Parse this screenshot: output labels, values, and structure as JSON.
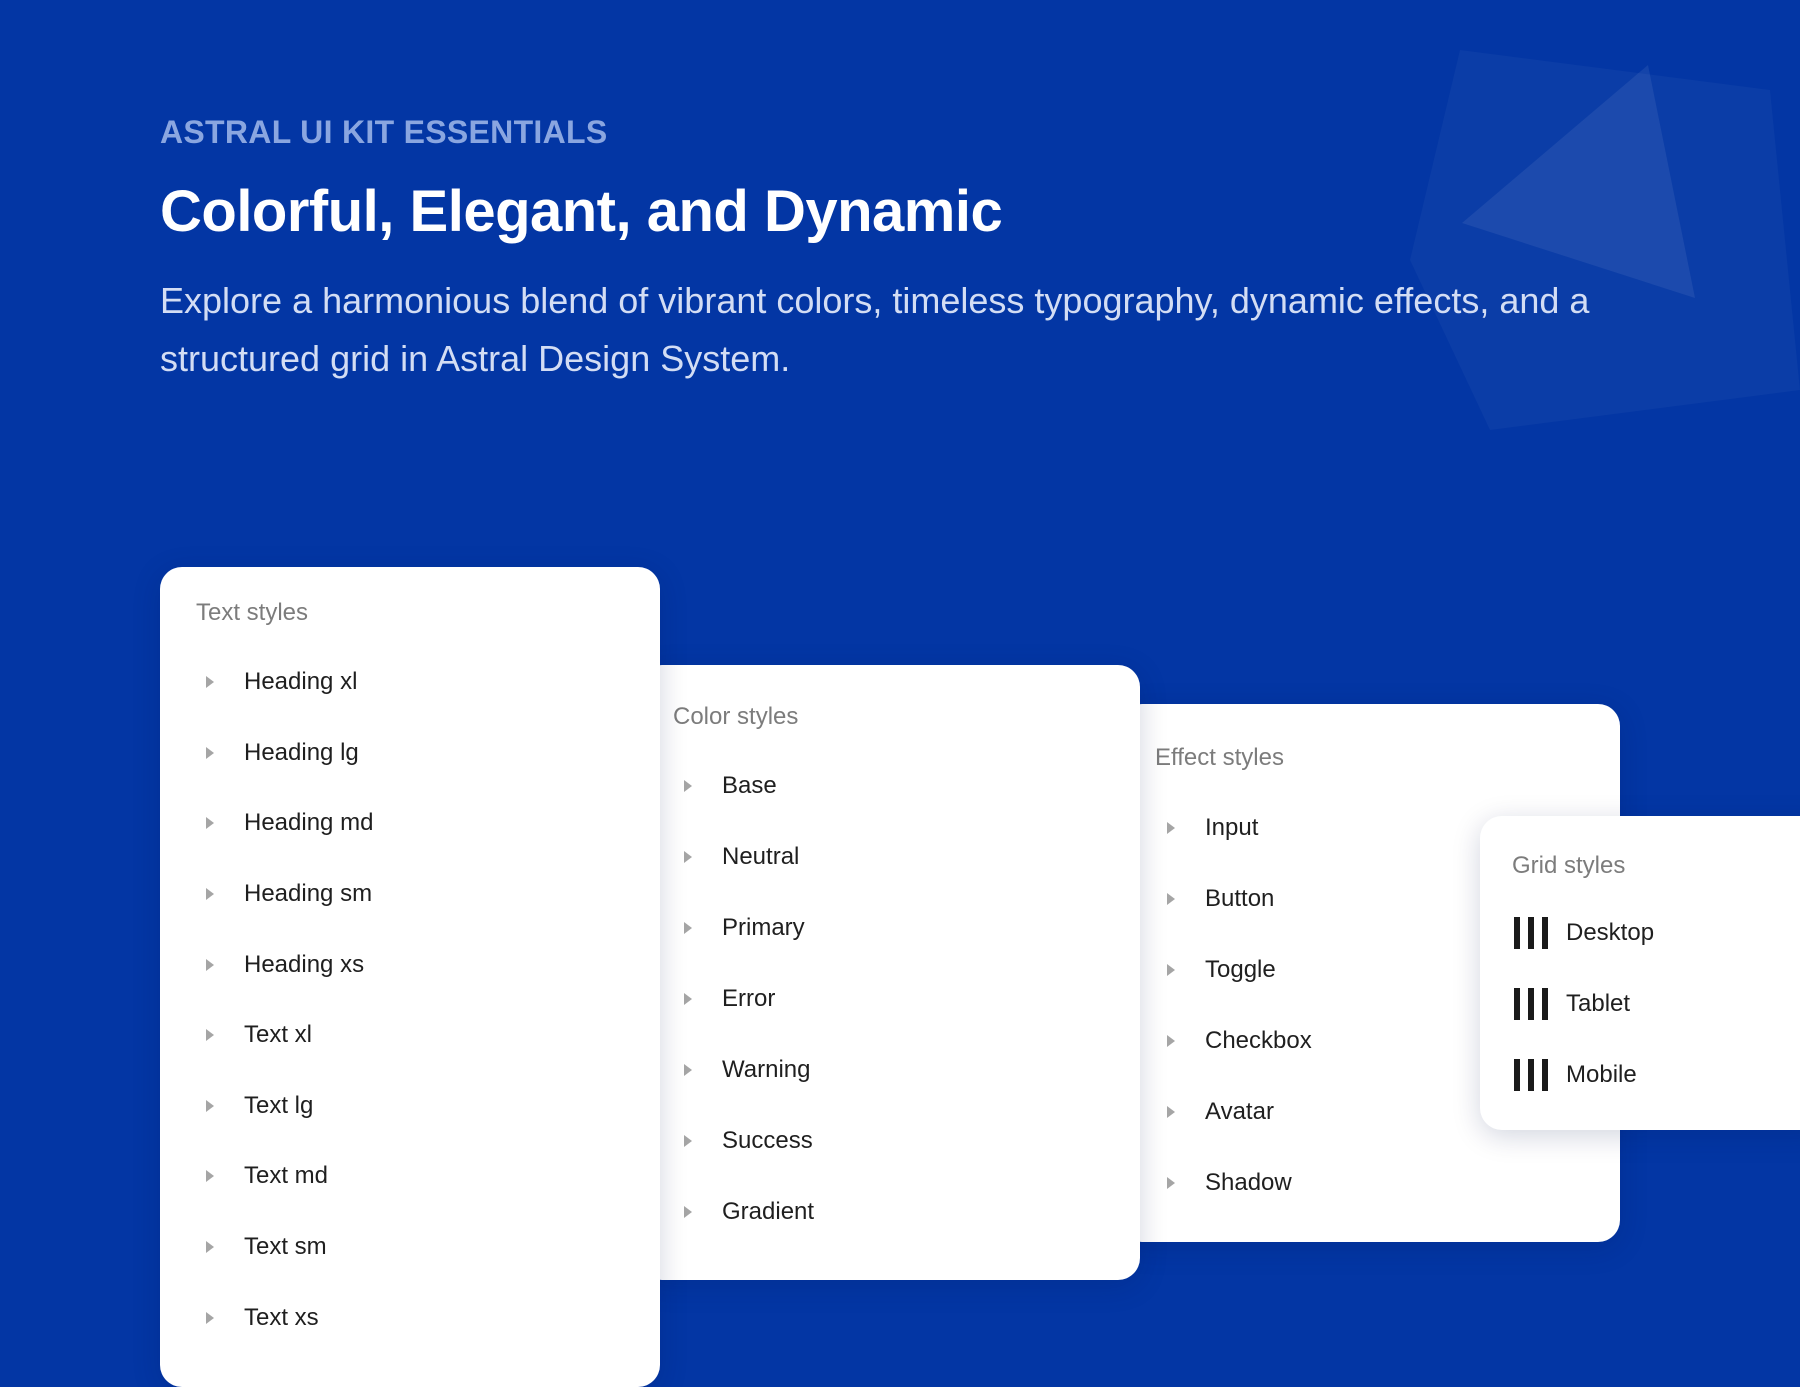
{
  "colors": {
    "background": "#0336a4",
    "eyebrow": "#8aa6e0",
    "headline": "#ffffff",
    "description": "#d3ddf4",
    "panel": "#ffffff",
    "panel_title": "#7c7c7c",
    "item_text": "#1f1f1f",
    "caret": "#a5a5a5"
  },
  "hero": {
    "eyebrow": "ASTRAL UI KIT ESSENTIALS",
    "headline": "Colorful, Elegant, and Dynamic",
    "description": "Explore a harmonious blend of vibrant colors, timeless typography, dynamic effects, and a structured grid in Astral Design System."
  },
  "text_styles": {
    "title": "Text styles",
    "icon": "caret-right-icon",
    "items": [
      "Heading xl",
      "Heading lg",
      "Heading md",
      "Heading sm",
      "Heading xs",
      "Text xl",
      "Text lg",
      "Text md",
      "Text sm",
      "Text xs"
    ]
  },
  "color_styles": {
    "title": "Color styles",
    "icon": "caret-right-icon",
    "items": [
      "Base",
      "Neutral",
      "Primary",
      "Error",
      "Warning",
      "Success",
      "Gradient"
    ]
  },
  "effect_styles": {
    "title": "Effect styles",
    "icon": "caret-right-icon",
    "items": [
      "Input",
      "Button",
      "Toggle",
      "Checkbox",
      "Avatar",
      "Shadow"
    ]
  },
  "grid_styles": {
    "title": "Grid styles",
    "icon": "grid-columns-icon",
    "items": [
      "Desktop",
      "Tablet",
      "Mobile"
    ]
  }
}
